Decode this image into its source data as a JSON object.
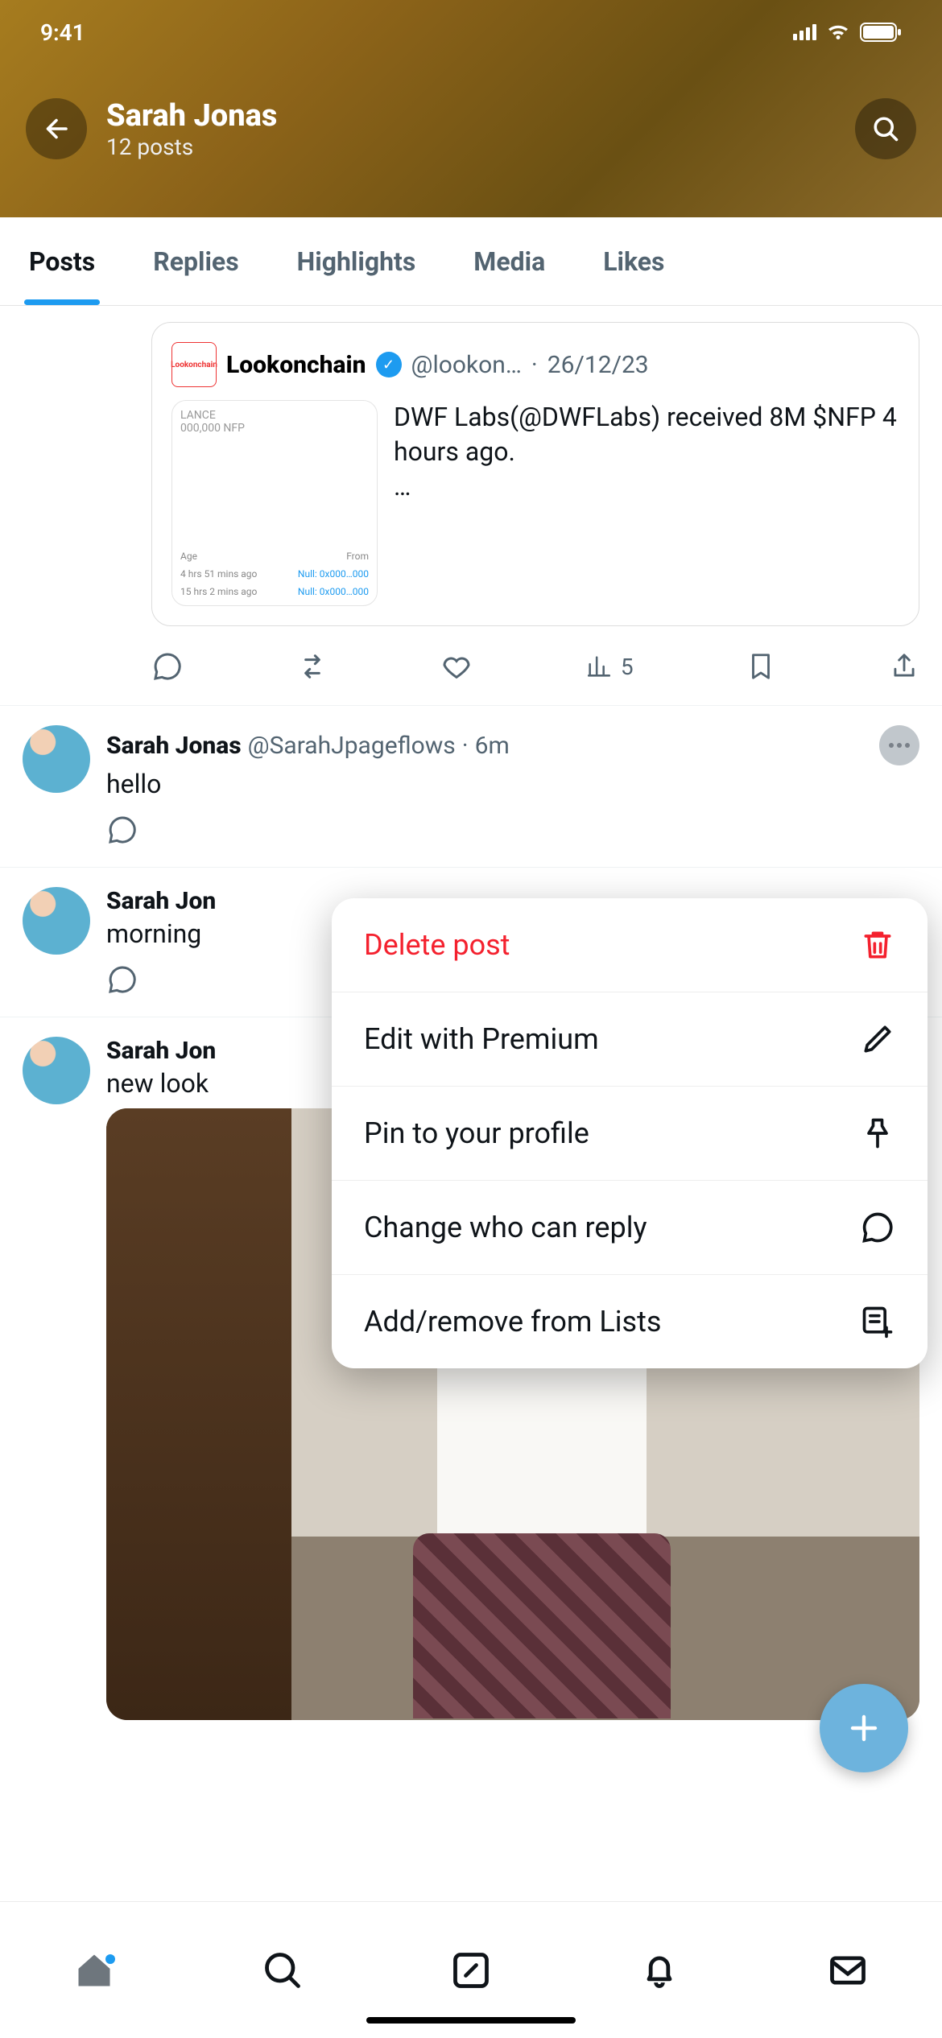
{
  "status": {
    "time": "9:41"
  },
  "header": {
    "name": "Sarah Jonas",
    "subtitle": "12 posts"
  },
  "tabs": [
    {
      "label": "Posts",
      "active": true
    },
    {
      "label": "Replies"
    },
    {
      "label": "Highlights"
    },
    {
      "label": "Media"
    },
    {
      "label": "Likes"
    }
  ],
  "quoted": {
    "source": {
      "name": "Lookonchain",
      "handle": "@lookon…",
      "date": "26/12/23"
    },
    "text": "DWF Labs(@DWFLabs) received 8M $NFP 4 hours ago.",
    "ellipsis": "…",
    "thumb": {
      "line1": "LANCE",
      "line2": "000,000 NFP",
      "ageLabel": "Age",
      "fromLabel": "From",
      "row1a": "4 hrs 51 mins ago",
      "row1b": "Null: 0x000…000",
      "row2a": "15 hrs 2 mins ago",
      "row2b": "Null: 0x000…000"
    },
    "views": "5"
  },
  "posts": [
    {
      "name": "Sarah Jonas",
      "handle": "@SarahJpageflows",
      "time": "6m",
      "text": "hello"
    },
    {
      "name": "Sarah Jon",
      "text": "morning"
    },
    {
      "name": "Sarah Jon",
      "text": "new look"
    }
  ],
  "menu": {
    "delete": "Delete post",
    "edit": "Edit with Premium",
    "pin": "Pin to your profile",
    "reply": "Change who can reply",
    "lists": "Add/remove from Lists"
  },
  "colors": {
    "accent": "#1d9bf0",
    "danger": "#f4212e"
  }
}
